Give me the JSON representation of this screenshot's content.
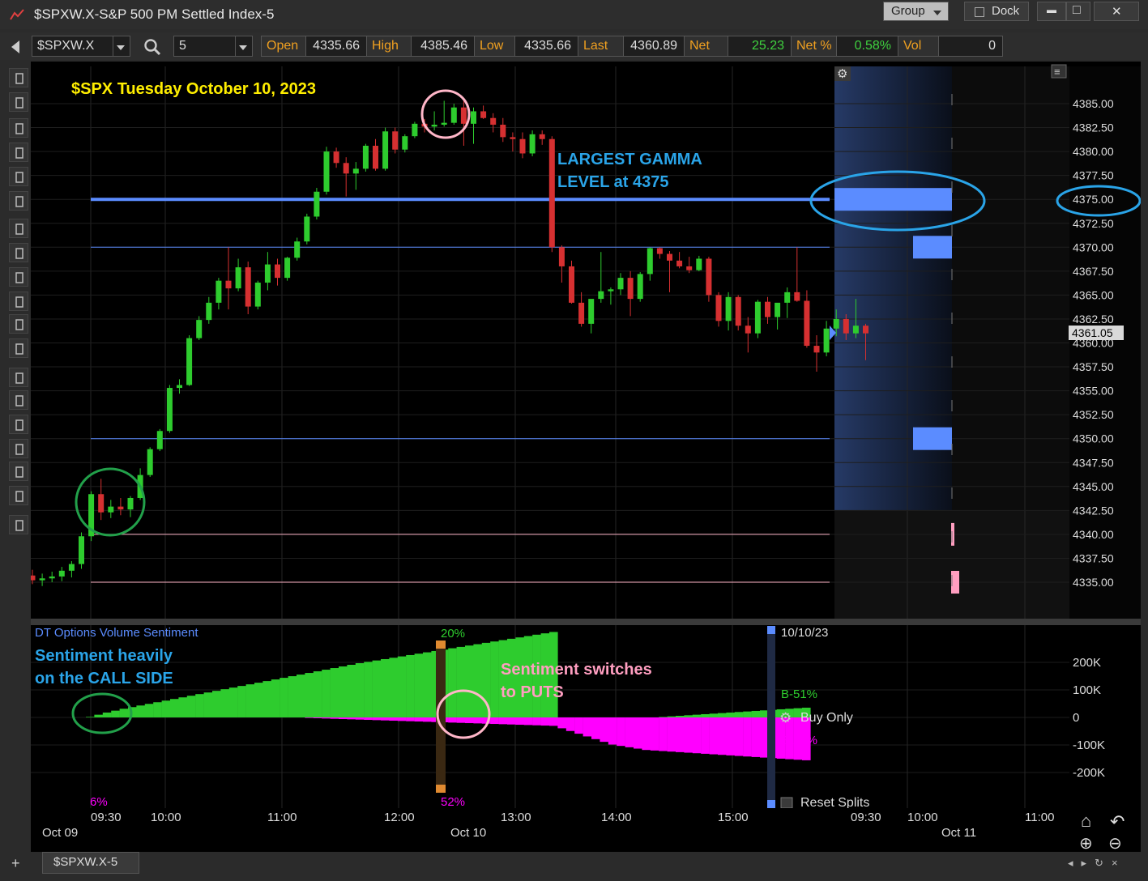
{
  "window": {
    "title": "$SPXW.X-S&P 500 PM Settled Index-5",
    "group_label": "Group",
    "dock_label": "Dock",
    "minimize_glyph": "▬",
    "maximize_glyph": "□",
    "close_glyph": "✕"
  },
  "symbol_bar": {
    "symbol": "$SPXW.X",
    "interval": "5",
    "quote": [
      {
        "label": "Open",
        "value": "4335.66"
      },
      {
        "label": "High",
        "value": "4385.46"
      },
      {
        "label": "Low",
        "value": "4335.66"
      },
      {
        "label": "Last",
        "value": "4360.89"
      },
      {
        "label": "Net",
        "value": "25.23"
      },
      {
        "label": "Net %",
        "value": "0.58%"
      },
      {
        "label": "Vol",
        "value": "0"
      }
    ]
  },
  "toolbar_icons": [
    "crosshair-icon",
    "cursor-icon",
    "candlestick-icon",
    "bar-chart-icon",
    "line-chart-icon",
    "mountain-chart-icon",
    "scale-icon",
    "trend-line-icon",
    "grid-icon",
    "table-icon",
    "window-icon",
    "anchor-icon",
    "pin-icon",
    "note-icon",
    "home-icon",
    "undo-icon",
    "zoom-in-icon",
    "zoom-out-icon",
    "pointer-icon"
  ],
  "annotations": {
    "chart_title": "$SPX Tuesday October 10, 2023",
    "gamma_label_line1": "LARGEST GAMMA",
    "gamma_label_line2": "LEVEL at 4375",
    "sentiment_call_line1": "Sentiment heavily",
    "sentiment_call_line2": "on the CALL SIDE",
    "sentiment_puts_line1": "Sentiment switches",
    "sentiment_puts_line2": "to PUTS"
  },
  "indicator": {
    "name": "DT Options Volume Sentiment",
    "pct_top": "20%",
    "pct_bottom_left": "6%",
    "pct_bottom_mid": "52%",
    "date": "10/10/23",
    "buy_label": "B-51%",
    "sell_label": "B-29%",
    "buy_only": "Buy Only",
    "reset_splits": "Reset Splits",
    "y_ticks": [
      "200K",
      "100K",
      "0",
      "-100K",
      "-200K"
    ]
  },
  "price_axis": {
    "ticks": [
      "4385.00",
      "4382.50",
      "4380.00",
      "4377.50",
      "4375.00",
      "4372.50",
      "4370.00",
      "4367.50",
      "4365.00",
      "4362.50",
      "4360.00",
      "4357.50",
      "4355.00",
      "4352.50",
      "4350.00",
      "4347.50",
      "4345.00",
      "4342.50",
      "4340.00",
      "4337.50",
      "4335.00"
    ],
    "last_price": "4361.05"
  },
  "time_axis": {
    "times": [
      "09:30",
      "10:00",
      "11:00",
      "12:00",
      "13:00",
      "14:00",
      "15:00",
      "09:30",
      "10:00",
      "11:00"
    ],
    "dates": [
      "Oct 09",
      "Oct 10",
      "Oct 11"
    ]
  },
  "tab": {
    "label": "$SPXW.X-5"
  },
  "colors": {
    "up": "#2ecc2e",
    "down": "#d63031",
    "gamma": "#5b8cff",
    "annotation_yellow": "#ffee00",
    "annotation_blue": "#2aa4e8",
    "annotation_pink": "#ff9ec0",
    "sentiment_call": "#2ecc2e",
    "sentiment_put": "#ff00ff"
  },
  "chart_data": {
    "type": "candlestick",
    "symbol": "$SPXW.X",
    "interval_minutes": 5,
    "ylim": [
      4333.5,
      4388.5
    ],
    "horizontal_levels": [
      4375,
      4370,
      4350,
      4340,
      4335
    ],
    "gamma_bars": [
      {
        "price": 4375,
        "size": "large"
      },
      {
        "price": 4370,
        "size": "medium"
      },
      {
        "price": 4350,
        "size": "medium"
      },
      {
        "price": 4340,
        "size": "small"
      },
      {
        "price": 4335,
        "size": "small"
      }
    ],
    "candles": [
      [
        4335.7,
        4336.3,
        4334.8,
        4335.2
      ],
      [
        4335.2,
        4335.9,
        4334.6,
        4335.4
      ],
      [
        4335.4,
        4336.1,
        4335.0,
        4335.6
      ],
      [
        4335.6,
        4336.6,
        4335.1,
        4336.2
      ],
      [
        4336.2,
        4337.2,
        4335.5,
        4336.9
      ],
      [
        4336.9,
        4340.2,
        4336.4,
        4339.8
      ],
      [
        4339.8,
        4344.5,
        4339.3,
        4344.2
      ],
      [
        4344.2,
        4345.8,
        4341.5,
        4342.3
      ],
      [
        4342.3,
        4343.6,
        4341.7,
        4342.9
      ],
      [
        4342.9,
        4343.8,
        4342.0,
        4342.6
      ],
      [
        4342.6,
        4344.0,
        4341.8,
        4343.8
      ],
      [
        4343.8,
        4346.9,
        4343.6,
        4346.2
      ],
      [
        4346.2,
        4349.1,
        4346.0,
        4348.9
      ],
      [
        4348.9,
        4351.0,
        4348.7,
        4350.8
      ],
      [
        4350.8,
        4355.6,
        4350.6,
        4355.3
      ],
      [
        4355.3,
        4356.2,
        4354.7,
        4355.6
      ],
      [
        4355.6,
        4360.8,
        4355.5,
        4360.5
      ],
      [
        4360.5,
        4362.8,
        4360.3,
        4362.4
      ],
      [
        4362.4,
        4364.8,
        4362.0,
        4364.2
      ],
      [
        4364.2,
        4366.8,
        4363.5,
        4366.5
      ],
      [
        4366.5,
        4370.0,
        4363.5,
        4365.7
      ],
      [
        4365.7,
        4368.8,
        4365.4,
        4367.9
      ],
      [
        4367.9,
        4368.5,
        4363.0,
        4363.8
      ],
      [
        4363.8,
        4366.5,
        4363.5,
        4366.3
      ],
      [
        4366.3,
        4369.5,
        4365.5,
        4368.2
      ],
      [
        4368.2,
        4368.8,
        4366.0,
        4366.8
      ],
      [
        4366.8,
        4369.0,
        4366.5,
        4368.9
      ],
      [
        4368.9,
        4371.0,
        4368.6,
        4370.6
      ],
      [
        4370.6,
        4373.5,
        4370.3,
        4373.2
      ],
      [
        4373.2,
        4376.2,
        4372.9,
        4375.8
      ],
      [
        4375.8,
        4380.5,
        4375.5,
        4380.0
      ],
      [
        4380.0,
        4380.4,
        4378.3,
        4378.8
      ],
      [
        4378.8,
        4379.4,
        4375.3,
        4377.7
      ],
      [
        4377.7,
        4378.9,
        4376.0,
        4378.2
      ],
      [
        4378.2,
        4380.8,
        4377.9,
        4380.6
      ],
      [
        4380.6,
        4381.3,
        4378.0,
        4378.2
      ],
      [
        4378.2,
        4382.5,
        4378.0,
        4382.1
      ],
      [
        4382.1,
        4382.5,
        4379.8,
        4380.2
      ],
      [
        4380.2,
        4381.8,
        4379.9,
        4381.6
      ],
      [
        4381.6,
        4383.1,
        4381.4,
        4382.9
      ],
      [
        4382.9,
        4383.4,
        4382.0,
        4382.6
      ],
      [
        4382.6,
        4384.2,
        4382.2,
        4382.8
      ],
      [
        4382.8,
        4385.3,
        4382.6,
        4383.0
      ],
      [
        4383.0,
        4385.0,
        4382.8,
        4384.6
      ],
      [
        4384.6,
        4385.5,
        4380.6,
        4382.9
      ],
      [
        4382.9,
        4384.6,
        4380.8,
        4384.2
      ],
      [
        4384.2,
        4384.8,
        4383.4,
        4383.5
      ],
      [
        4383.5,
        4384.0,
        4382.0,
        4382.8
      ],
      [
        4382.8,
        4383.5,
        4381.0,
        4381.5
      ],
      [
        4381.5,
        4382.0,
        4380.0,
        4381.3
      ],
      [
        4381.3,
        4382.0,
        4379.3,
        4379.8
      ],
      [
        4379.8,
        4382.2,
        4379.5,
        4381.8
      ],
      [
        4381.8,
        4382.2,
        4380.7,
        4381.3
      ],
      [
        4381.3,
        4381.6,
        4369.5,
        4370.0
      ],
      [
        4370.0,
        4370.2,
        4366.3,
        4368.0
      ],
      [
        4368.0,
        4368.6,
        4364.1,
        4364.2
      ],
      [
        4364.2,
        4365.3,
        4361.7,
        4362.0
      ],
      [
        4362.0,
        4363.0,
        4361.0,
        4364.6
      ],
      [
        4364.6,
        4369.5,
        4364.2,
        4365.4
      ],
      [
        4365.4,
        4365.8,
        4364.0,
        4365.6
      ],
      [
        4365.6,
        4367.3,
        4365.0,
        4366.8
      ],
      [
        4366.8,
        4367.5,
        4362.8,
        4364.6
      ],
      [
        4364.6,
        4367.4,
        4364.3,
        4367.2
      ],
      [
        4367.2,
        4370.0,
        4366.5,
        4369.9
      ],
      [
        4369.9,
        4370.0,
        4368.8,
        4369.3
      ],
      [
        4369.3,
        4369.6,
        4365.3,
        4368.6
      ],
      [
        4368.6,
        4369.5,
        4367.8,
        4368.0
      ],
      [
        4368.0,
        4369.0,
        4367.3,
        4367.6
      ],
      [
        4367.6,
        4369.1,
        4367.5,
        4368.8
      ],
      [
        4368.8,
        4369.0,
        4364.3,
        4365.0
      ],
      [
        4365.0,
        4365.3,
        4361.7,
        4362.3
      ],
      [
        4362.3,
        4365.3,
        4361.3,
        4364.8
      ],
      [
        4364.8,
        4365.0,
        4361.3,
        4361.8
      ],
      [
        4361.8,
        4362.7,
        4359.0,
        4361.0
      ],
      [
        4361.0,
        4364.5,
        4360.5,
        4364.3
      ],
      [
        4364.3,
        4364.8,
        4362.0,
        4362.7
      ],
      [
        4362.7,
        4364.0,
        4361.4,
        4364.2
      ],
      [
        4364.2,
        4365.8,
        4362.6,
        4365.3
      ],
      [
        4365.3,
        4370.0,
        4364.3,
        4364.4
      ],
      [
        4364.4,
        4365.5,
        4359.5,
        4359.7
      ],
      [
        4359.7,
        4360.8,
        4357.0,
        4359.0
      ],
      [
        4359.0,
        4362.3,
        4358.6,
        4361.5
      ],
      [
        4361.5,
        4363.5,
        4360.7,
        4362.5
      ],
      [
        4362.5,
        4363.0,
        4360.3,
        4361.0
      ],
      [
        4361.0,
        4364.6,
        4360.5,
        4361.8
      ],
      [
        4361.8,
        4362.0,
        4358.2,
        4361.0
      ]
    ],
    "sentiment": {
      "name": "DT Options Volume Sentiment",
      "call_side_k": [
        2,
        10,
        18,
        25,
        32,
        38,
        44,
        50,
        56,
        62,
        68,
        74,
        80,
        86,
        92,
        98,
        104,
        110,
        116,
        122,
        128,
        134,
        140,
        146,
        152,
        158,
        164,
        170,
        176,
        182,
        188,
        194,
        200,
        205,
        210,
        215,
        220,
        225,
        230,
        235,
        240,
        245,
        250,
        255,
        260,
        265,
        270,
        275,
        280,
        285,
        290,
        295,
        300,
        305,
        310,
        315,
        0,
        0,
        0,
        0,
        0,
        0,
        0,
        0,
        0,
        0,
        0,
        0,
        2,
        4,
        6,
        8,
        10,
        12,
        14,
        16,
        18,
        20,
        22,
        24,
        26,
        28,
        30,
        32,
        34,
        36
      ],
      "put_side_k": [
        0,
        0,
        0,
        0,
        0,
        0,
        0,
        0,
        0,
        0,
        0,
        0,
        0,
        0,
        0,
        0,
        0,
        0,
        0,
        0,
        0,
        0,
        0,
        0,
        0,
        0,
        -2,
        -3,
        -4,
        -5,
        -6,
        -7,
        -8,
        -9,
        -10,
        -11,
        -12,
        -13,
        -14,
        -15,
        -16,
        -17,
        -18,
        -19,
        -20,
        -21,
        -22,
        -23,
        -24,
        -25,
        -26,
        -27,
        -28,
        -29,
        -30,
        -31,
        -40,
        -50,
        -60,
        -70,
        -80,
        -90,
        -100,
        -105,
        -110,
        -115,
        -120,
        -122,
        -124,
        -126,
        -128,
        -130,
        -132,
        -134,
        -136,
        -138,
        -140,
        -142,
        -144,
        -146,
        -148,
        -150,
        -152,
        -154,
        -156,
        -158
      ],
      "ylim_k": [
        -300,
        300
      ]
    }
  }
}
